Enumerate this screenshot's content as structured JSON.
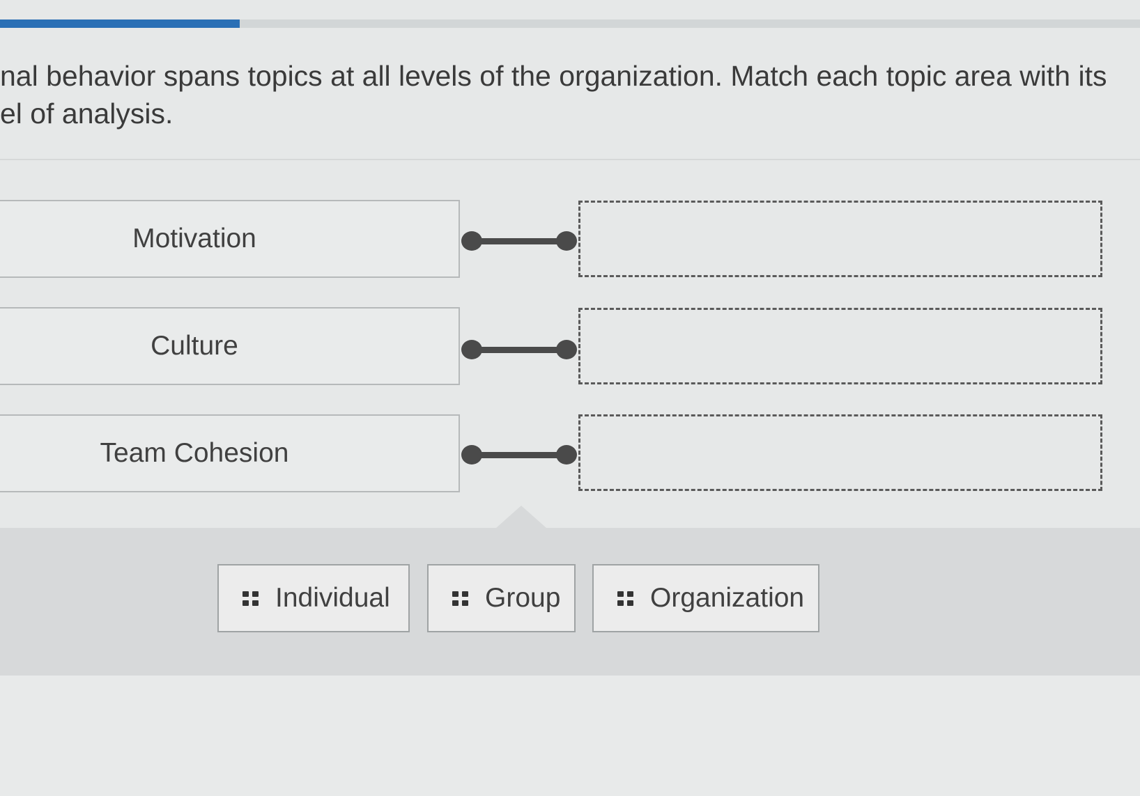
{
  "progress": {
    "fraction": 0.21,
    "fill_color": "#2a6fb5"
  },
  "question": {
    "line1": "nal behavior spans topics at all levels of the organization. Match each topic area with its",
    "line2": "el of analysis."
  },
  "prompts": [
    {
      "label": "Motivation"
    },
    {
      "label": "Culture"
    },
    {
      "label": "Team Cohesion"
    }
  ],
  "answers": [
    {
      "label": "Individual",
      "icon": "drag-grip-icon"
    },
    {
      "label": "Group",
      "icon": "drag-grip-icon"
    },
    {
      "label": "Organization",
      "icon": "drag-grip-icon"
    }
  ]
}
